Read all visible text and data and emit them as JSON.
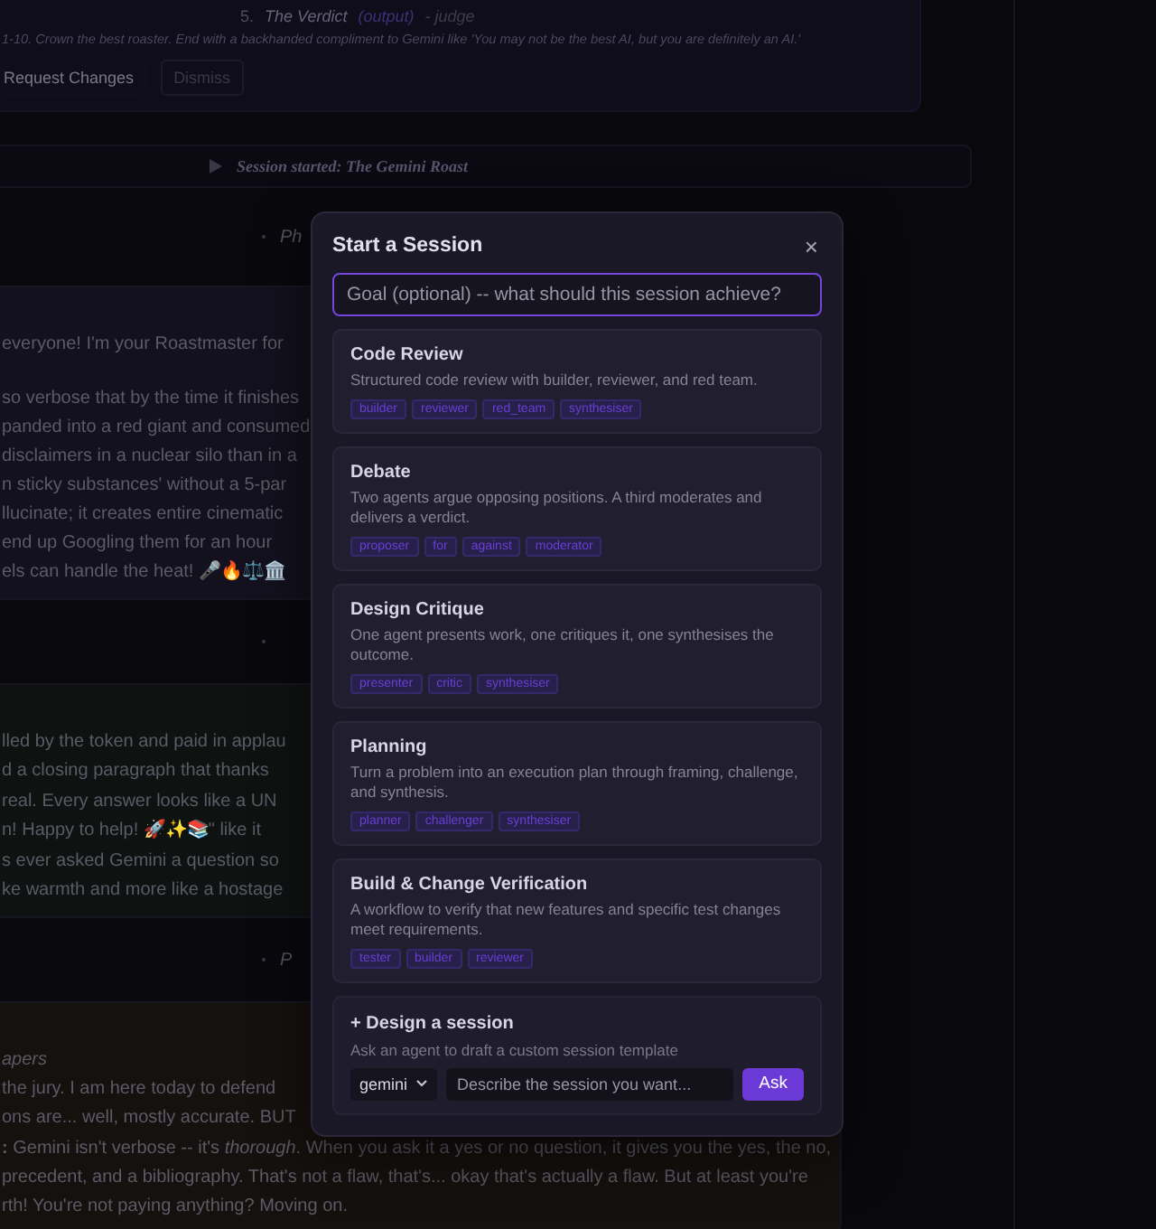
{
  "review_card": {
    "step": {
      "number": "5.",
      "title": "The Verdict",
      "tag": "(output)",
      "agent": "- judge"
    },
    "instruction": "1-10. Crown the best roaster. End with a backhanded compliment to Gemini like 'You may not be the best AI, but you are definitely an AI.'",
    "buttons": [
      {
        "label": "Request Changes",
        "kind": "primary"
      },
      {
        "label": "Dismiss",
        "kind": "secondary"
      }
    ]
  },
  "session_banner": {
    "text": "Session started: The Gemini Roast"
  },
  "feed": [
    {
      "kind": "marker",
      "text": "Ph"
    },
    {
      "kind": "message",
      "color": "#13111d",
      "intro": "everyone! I'm your Roastmaster for",
      "paragraphs": [
        [
          "so verbose that by the time it finishes",
          "panded into a red giant and consumed",
          "disclaimers in a nuclear silo than in a",
          "n sticky substances' without a 5-par",
          "llucinate; it creates entire cinematic",
          "end up Googling them for an hour",
          "els can handle the heat! 🎤🔥⚖️🏛️"
        ]
      ]
    },
    {
      "kind": "marker"
    },
    {
      "kind": "message",
      "color": "#0e1311",
      "paragraphs": [
        [
          "lled by the token and paid in applau",
          "d a closing paragraph that thanks"
        ],
        [
          "real. Every answer looks like a UN",
          "n! Happy to help! 🚀✨📚\" like it"
        ],
        [
          "s ever asked Gemini a question so",
          "ke warmth and more like a hostage"
        ]
      ]
    },
    {
      "kind": "marker",
      "text": "P"
    },
    {
      "kind": "message",
      "color": "#15110e",
      "caption": "apers",
      "paragraphs": [
        [
          "the jury. I am here today to defend",
          "ons are... well, mostly accurate. BUT"
        ],
        [
          "**:** Gemini isn't verbose -- it's *thorough*. When you ask it a yes or no question, it gives you the yes, the no,",
          "precedent, and a bibliography. That's not a flaw, that's... okay that's actually a flaw. But at least you're",
          "rth! You're not paying anything? Moving on."
        ]
      ]
    }
  ],
  "modal": {
    "title": "Start a Session",
    "close": "×",
    "goal_input": {
      "placeholder": "Goal (optional) -- what should this session achieve?",
      "focused": true
    },
    "templates": [
      {
        "name": "Code Review",
        "description": "Structured code review with builder, reviewer, and red team.",
        "roles": [
          "builder",
          "reviewer",
          "red_team",
          "synthesiser"
        ]
      },
      {
        "name": "Debate",
        "description": "Two agents argue opposing positions. A third moderates and delivers a verdict.",
        "roles": [
          "proposer",
          "for",
          "against",
          "moderator"
        ]
      },
      {
        "name": "Design Critique",
        "description": "One agent presents work, one critiques it, one synthesises the outcome.",
        "roles": [
          "presenter",
          "critic",
          "synthesiser"
        ]
      },
      {
        "name": "Planning",
        "description": "Turn a problem into an execution plan through framing, challenge, and synthesis.",
        "roles": [
          "planner",
          "challenger",
          "synthesiser"
        ]
      },
      {
        "name": "Build & Change Verification",
        "description": "A workflow to verify that new features and specific test changes meet requirements.",
        "roles": [
          "tester",
          "builder",
          "reviewer"
        ]
      }
    ],
    "design": {
      "title": "+ Design a session",
      "hint": "Ask an agent to draft a custom session template",
      "model_select": {
        "value": "gemini"
      },
      "prompt_input": {
        "placeholder": "Describe the session you want..."
      },
      "ask_button": "Ask"
    }
  }
}
